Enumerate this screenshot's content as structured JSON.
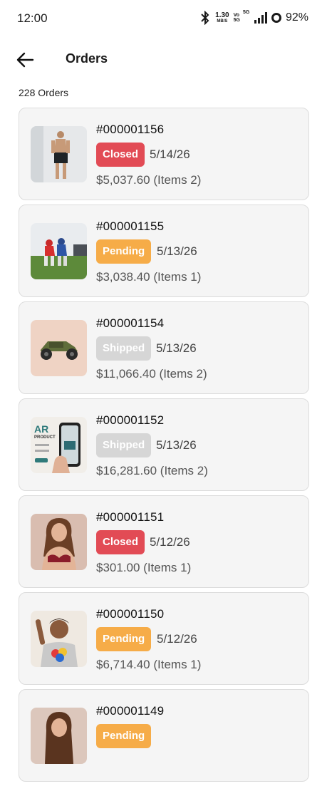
{
  "status_bar": {
    "time": "12:00",
    "speed_value": "1.30",
    "speed_unit": "MB/S",
    "volte_top": "Vo",
    "volte_bottom": "5G",
    "network": "5G",
    "battery": "92%"
  },
  "header": {
    "title": "Orders",
    "back_icon": "arrow-left-icon"
  },
  "order_count": "228 Orders",
  "colors": {
    "closed": "#e24b55",
    "pending": "#f6ac48",
    "shipped": "#d6d6d6",
    "card_bg": "#f5f5f5"
  },
  "orders": [
    {
      "id": "#000001156",
      "status": "Closed",
      "date": "5/14/26",
      "total": "$5,037.60 (Items 2)",
      "thumb": "man-in-shorts-photo"
    },
    {
      "id": "#000001155",
      "status": "Pending",
      "date": "5/13/26",
      "total": "$3,038.40 (Items 1)",
      "thumb": "football-players-photo"
    },
    {
      "id": "#000001154",
      "status": "Shipped",
      "date": "5/13/26",
      "total": "$11,066.40 (Items 2)",
      "thumb": "toy-buggy-car-photo"
    },
    {
      "id": "#000001152",
      "status": "Shipped",
      "date": "5/13/26",
      "total": "$16,281.60 (Items 2)",
      "thumb": "ar-product-app-photo",
      "thumb_text_1": "AR",
      "thumb_text_2": "PRODUCT"
    },
    {
      "id": "#000001151",
      "status": "Closed",
      "date": "5/12/26",
      "total": "$301.00 (Items 1)",
      "thumb": "woman-in-bra-photo"
    },
    {
      "id": "#000001150",
      "status": "Pending",
      "date": "5/12/26",
      "total": "$6,714.40 (Items 1)",
      "thumb": "child-in-tshirt-photo"
    },
    {
      "id": "#000001149",
      "status": "Pending",
      "date": "",
      "total": "",
      "thumb": "woman-portrait-photo"
    }
  ]
}
